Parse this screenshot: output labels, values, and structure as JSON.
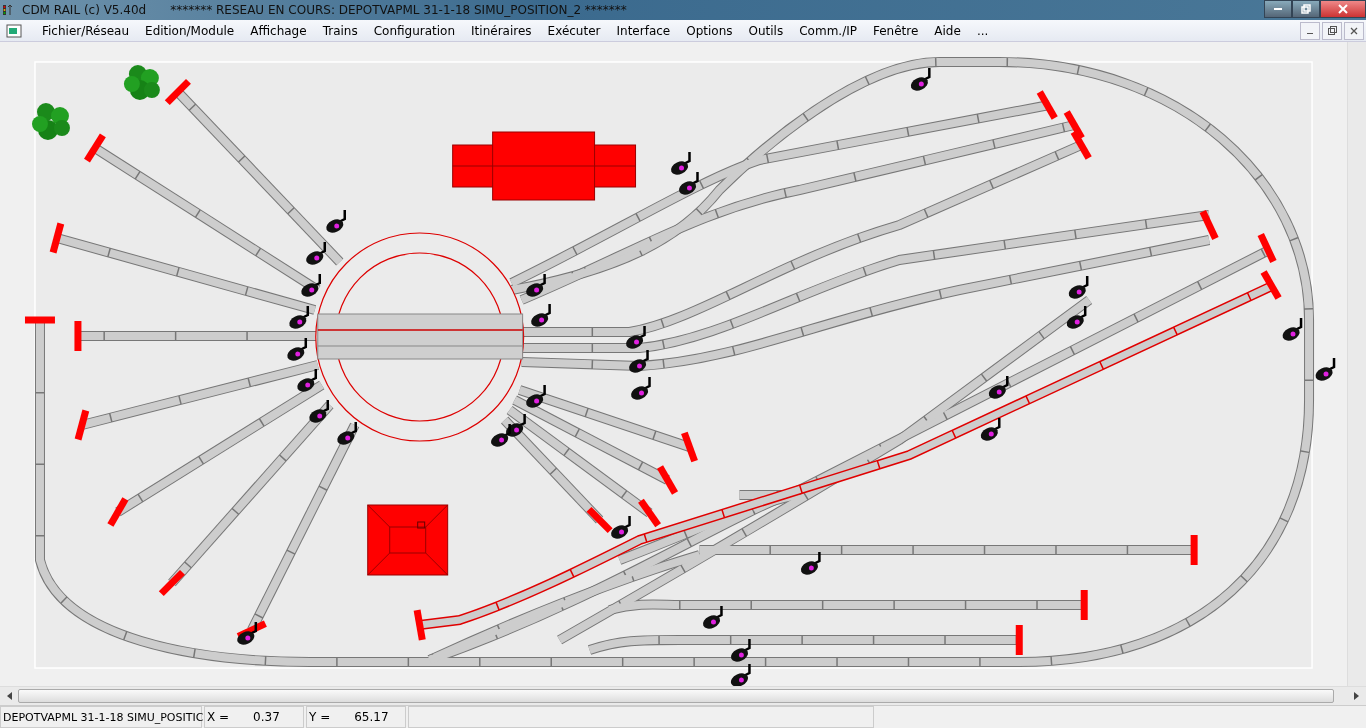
{
  "window": {
    "title": "CDM RAIL (c) V5.40d",
    "document_title": "******* RESEAU EN COURS: DEPOTVAPML 31-1-18 SIMU_POSITION_2 *******"
  },
  "menu": [
    "Fichier/Réseau",
    "Edition/Module",
    "Affichage",
    "Trains",
    "Configuration",
    "Itinéraires",
    "Exécuter",
    "Interface",
    "Options",
    "Outils",
    "Comm./IP",
    "Fenêtre",
    "Aide",
    "..."
  ],
  "status_bar": {
    "file": "DEPOTVAPML 31-1-18 SIMU_POSITIC",
    "x_label": "X =",
    "x_value": "0.37",
    "y_label": "Y =",
    "y_value": "65.17"
  }
}
